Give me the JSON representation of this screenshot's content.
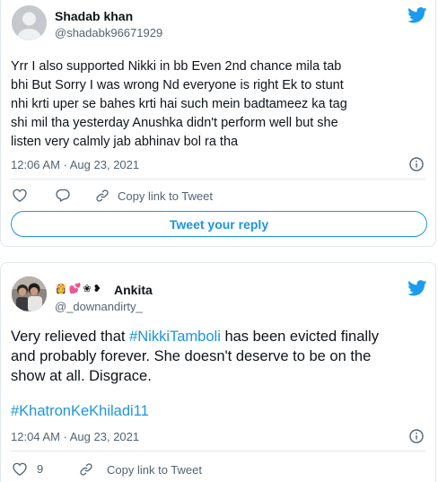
{
  "tweet1": {
    "author_name": "Shadab khan",
    "author_handle": "@shadabk96671929",
    "body_lines": [
      "Yrr I also supported Nikki in bb Even 2nd chance mila tab",
      "bhi But Sorry I was wrong Nd everyone is  right Ek to stunt",
      "nhi krti uper se bahes krti hai such mein badtameez ka tag",
      "shi mil tha  yesterday Anushka didn't perform well but she",
      "listen very calmly jab abhinav bol ra tha"
    ],
    "timestamp": "12:06 AM · Aug 23, 2021",
    "actions": {
      "like_icon": "heart-icon",
      "reply_icon": "comment-icon",
      "copy_link_label": "Copy link to Tweet"
    },
    "reply_button_label": "Tweet your reply"
  },
  "tweet2": {
    "author_name": "Ankita",
    "author_handle": "@_downandirty_",
    "name_emojis": [
      "👸",
      "💕",
      "❀",
      "❥"
    ],
    "body_lines": [
      {
        "before": "Very relieved that ",
        "link": "#NikkiTamboli",
        "after": " has been evicted finally"
      },
      {
        "before": "and probably forever. She doesn't deserve to be on the",
        "link": "",
        "after": ""
      },
      {
        "before": "show at all. Disgrace.",
        "link": "",
        "after": ""
      }
    ],
    "hashtag_line": "#KhatronKeKhiladi11",
    "timestamp": "12:04 AM · Aug 23, 2021",
    "actions": {
      "like_count": "9",
      "copy_link_label": "Copy link to Tweet"
    }
  },
  "colors": {
    "twitter_blue": "#1b95e0",
    "text_primary": "#0f1419",
    "text_secondary": "#536471",
    "border": "#e1e8ed"
  }
}
